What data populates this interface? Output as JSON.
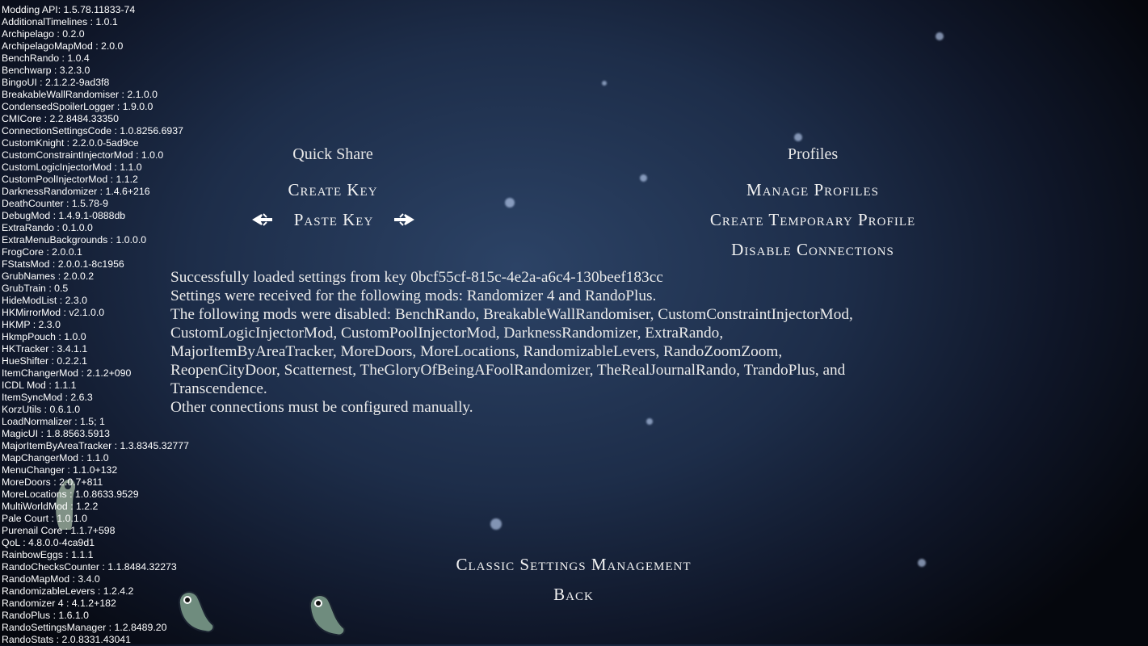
{
  "mod_list": [
    "Modding API: 1.5.78.11833-74",
    "AdditionalTimelines : 1.0.1",
    "Archipelago : 0.2.0",
    "ArchipelagoMapMod : 2.0.0",
    "BenchRando : 1.0.4",
    "Benchwarp : 3.2.3.0",
    "BingoUI : 2.1.2.2-9ad3f8",
    "BreakableWallRandomiser : 2.1.0.0",
    "CondensedSpoilerLogger : 1.9.0.0",
    "CMICore : 2.2.8484.33350",
    "ConnectionSettingsCode : 1.0.8256.6937",
    "CustomKnight : 2.2.0.0-5ad9ce",
    "CustomConstraintInjectorMod : 1.0.0",
    "CustomLogicInjectorMod : 1.1.0",
    "CustomPoolInjectorMod : 1.1.2",
    "DarknessRandomizer : 1.4.6+216",
    "DeathCounter : 1.5.78-9",
    "DebugMod : 1.4.9.1-0888db",
    "ExtraRando : 0.1.0.0",
    "ExtraMenuBackgrounds : 1.0.0.0",
    "FrogCore : 2.0.0.1",
    "FStatsMod : 2.0.0.1-8c1956",
    "GrubNames : 2.0.0.2",
    "GrubTrain : 0.5",
    "HideModList : 2.3.0",
    "HKMirrorMod : v2.1.0.0",
    "HKMP : 2.3.0",
    "HkmpPouch : 1.0.0",
    "HKTracker : 3.4.1.1",
    "HueShifter : 0.2.2.1",
    "ItemChangerMod : 2.1.2+090",
    "ICDL Mod : 1.1.1",
    "ItemSyncMod : 2.6.3",
    "KorzUtils : 0.6.1.0",
    "LoadNormalizer : 1.5; 1",
    "MagicUI : 1.8.8563.5913",
    "MajorItemByAreaTracker : 1.3.8345.32777",
    "MapChangerMod : 1.1.0",
    "MenuChanger : 1.1.0+132",
    "MoreDoors : 2.0.7+811",
    "MoreLocations : 1.0.8633.9529",
    "MultiWorldMod : 1.2.2",
    "Pale Court : 1.0.1.0",
    "Purenail Core : 1.1.7+598",
    "QoL : 4.8.0.0-4ca9d1",
    "RainbowEggs : 1.1.1",
    "RandoChecksCounter : 1.1.8484.32273",
    "RandoMapMod : 3.4.0",
    "RandomizableLevers : 1.2.4.2",
    "Randomizer 4 : 4.1.2+182",
    "RandoPlus : 1.6.1.0",
    "RandoSettingsManager : 1.2.8489.20",
    "RandoStats : 2.0.8331.43041"
  ],
  "quick_share": {
    "header": "Quick Share",
    "create_key": "Create Key",
    "paste_key": "Paste Key"
  },
  "profiles": {
    "header": "Profiles",
    "manage": "Manage Profiles",
    "create_temp": "Create Temporary Profile",
    "disable_connections": "Disable Connections"
  },
  "message": [
    "Successfully loaded settings from key 0bcf55cf-815c-4e2a-a6c4-130beef183cc",
    "Settings were received for the following mods: Randomizer 4 and RandoPlus.",
    "The following mods were disabled: BenchRando, BreakableWallRandomiser, CustomConstraintInjectorMod,",
    "CustomLogicInjectorMod, CustomPoolInjectorMod, DarknessRandomizer, ExtraRando,",
    "MajorItemByAreaTracker, MoreDoors, MoreLocations, RandomizableLevers, RandoZoomZoom,",
    "ReopenCityDoor, Scatternest, TheGloryOfBeingAFoolRandomizer, TheRealJournalRando, TrandoPlus, and",
    "Transcendence.",
    "Other connections must be configured manually."
  ],
  "footer": {
    "classic": "Classic Settings Management",
    "back": "Back"
  },
  "icons": {
    "selector_left": "fleur-left-icon",
    "selector_right": "fleur-right-icon",
    "grub": "grub-sprite"
  },
  "colors": {
    "background": "#1d2d49",
    "text": "#ffffff",
    "grub": "#7f9c8a"
  }
}
